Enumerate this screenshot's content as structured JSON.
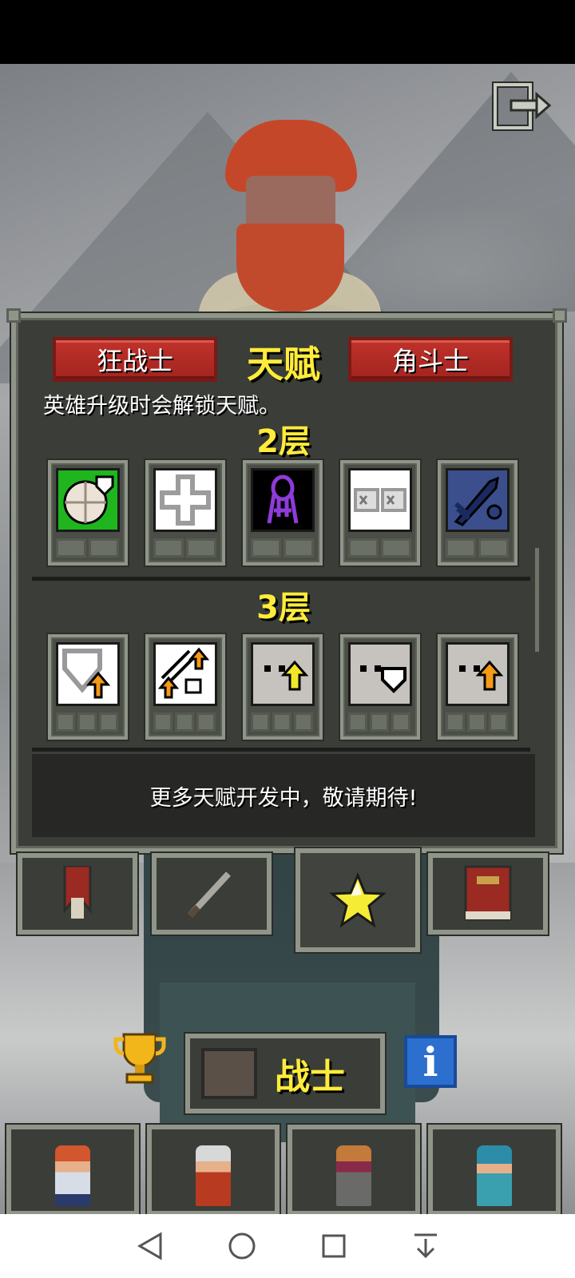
{
  "panel": {
    "title": "天赋",
    "left_button": "狂战士",
    "right_button": "角斗士",
    "description": "英雄升级时会解锁天赋。",
    "tier2_label": "2层",
    "tier3_label": "3层",
    "footer_note": "更多天赋开发中，敬请期待!",
    "tier2_talents": [
      {
        "icon": "shield-heal-icon",
        "bg": "#1fb51f",
        "max_points": 2
      },
      {
        "icon": "plus-cross-icon",
        "bg": "#ffffff",
        "max_points": 2
      },
      {
        "icon": "purple-knot-icon",
        "bg": "#000000",
        "max_points": 2
      },
      {
        "icon": "scrolls-icon",
        "bg": "#ffffff",
        "max_points": 2
      },
      {
        "icon": "blue-wand-icon",
        "bg": "#3a4f8c",
        "max_points": 2
      }
    ],
    "tier3_talents": [
      {
        "icon": "shield-up-icon",
        "bg": "#ffffff",
        "max_points": 3
      },
      {
        "icon": "weapons-up-icon",
        "bg": "#ffffff",
        "max_points": 3
      },
      {
        "icon": "face-yellow-arrow-icon",
        "bg": "#c6c2be",
        "max_points": 3
      },
      {
        "icon": "face-armor-icon",
        "bg": "#c6c2be",
        "max_points": 3
      },
      {
        "icon": "face-orange-arrow-icon",
        "bg": "#c6c2be",
        "max_points": 3
      }
    ]
  },
  "tabs": [
    {
      "name": "tab-stats",
      "icon": "banner-icon"
    },
    {
      "name": "tab-items",
      "icon": "sword-icon"
    },
    {
      "name": "tab-talents",
      "icon": "star-icon",
      "active": true
    },
    {
      "name": "tab-journal",
      "icon": "book-icon"
    }
  ],
  "hero": {
    "class_name": "战士"
  },
  "colors": {
    "accent_yellow": "#ffec3a",
    "red_button": "#c0322b",
    "panel_bg": "#3a3d38",
    "panel_border": "#8f9589"
  }
}
